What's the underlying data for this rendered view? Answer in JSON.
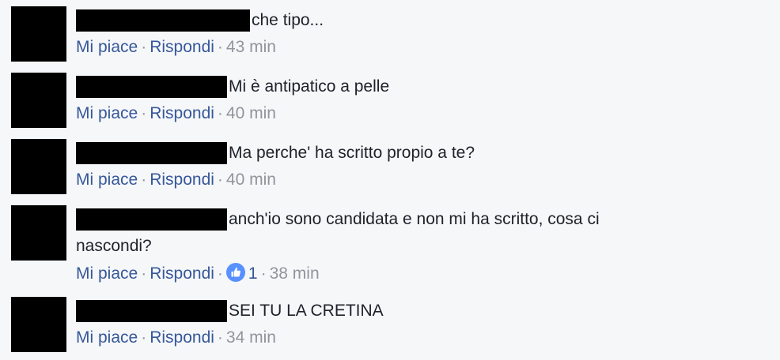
{
  "comments": [
    {
      "text": "che tipo...",
      "actions": {
        "like": "Mi piace",
        "reply": "Rispondi",
        "time": "43 min"
      }
    },
    {
      "text": "Mi è antipatico a pelle",
      "actions": {
        "like": "Mi piace",
        "reply": "Rispondi",
        "time": "40 min"
      }
    },
    {
      "text": "Ma perche' ha scritto propio a te?",
      "actions": {
        "like": "Mi piace",
        "reply": "Rispondi",
        "time": "40 min"
      }
    },
    {
      "text": "anch'io sono candidata e non mi ha scritto, cosa ci nascondi?",
      "actions": {
        "like": "Mi piace",
        "reply": "Rispondi",
        "time": "38 min",
        "reaction_icon": "like-thumb-icon",
        "reaction_count": "1"
      }
    },
    {
      "text": "SEI TU LA CRETINA",
      "actions": {
        "like": "Mi piace",
        "reply": "Rispondi",
        "time": "34 min"
      }
    }
  ],
  "colors": {
    "link": "#365899",
    "meta": "#90949c",
    "text": "#1d2129",
    "like_badge": "#5890ff",
    "background": "#f6f7f9"
  },
  "separator": "·"
}
